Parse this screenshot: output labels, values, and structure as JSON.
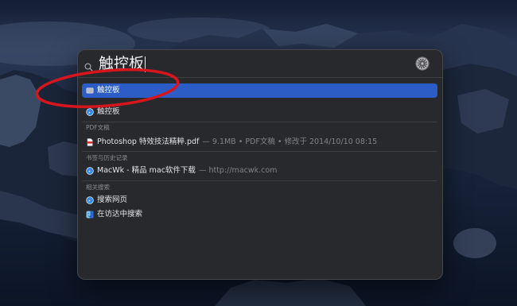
{
  "search": {
    "query": "触控板",
    "icon": "magnifier-icon",
    "preview_icon": "system-preferences-icon"
  },
  "top_hit": {
    "label": "触控板",
    "icon": "trackpad-icon",
    "selected": true
  },
  "results": [
    {
      "label": "触控板",
      "icon": "safari-icon"
    }
  ],
  "sections": [
    {
      "header": "PDF文稿",
      "items": [
        {
          "title": "Photoshop 特效技法精粹.pdf",
          "meta": "— 9.1MB • PDF文稿 • 修改于 2014/10/10 08:15",
          "icon": "pdf-icon"
        }
      ]
    },
    {
      "header": "书签与历史记录",
      "items": [
        {
          "title": "MacWk - 精品 mac软件下载",
          "meta": "— http://macwk.com",
          "icon": "safari-icon"
        }
      ]
    },
    {
      "header": "相关搜索",
      "items": [
        {
          "title": "搜索网页",
          "icon": "safari-icon"
        },
        {
          "title": "在访达中搜索",
          "icon": "finder-icon"
        }
      ]
    }
  ],
  "colors": {
    "selection": "#2c5cc5",
    "annotation": "#d6151d",
    "panel": "#28292c"
  }
}
